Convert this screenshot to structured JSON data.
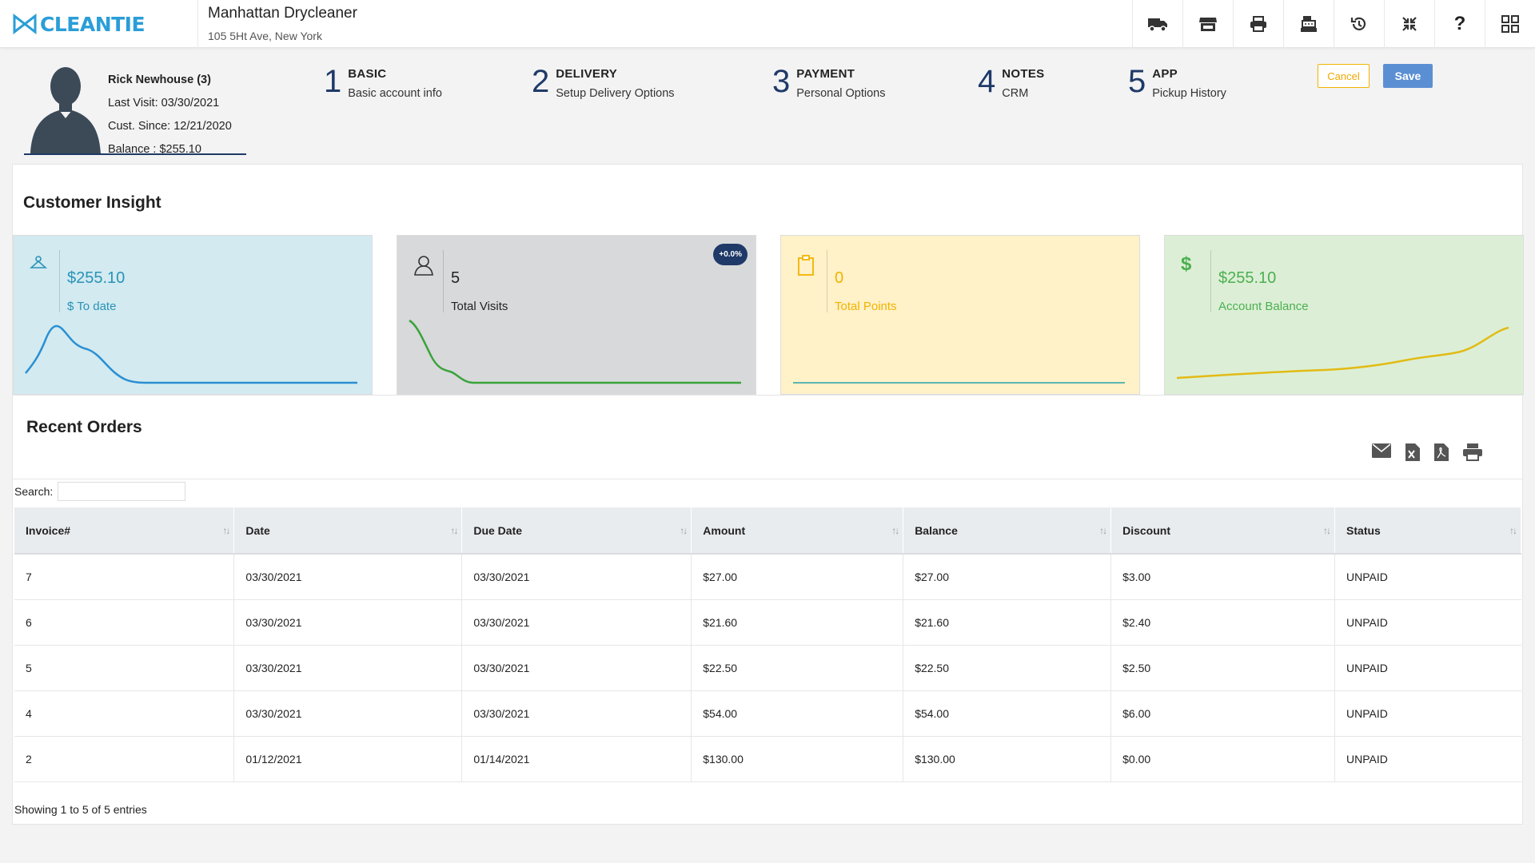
{
  "header": {
    "logo_text": "CLEANTIE",
    "store_name": "Manhattan Drycleaner",
    "store_address": "105 5Ht Ave, New York",
    "icons": [
      "truck-icon",
      "store-icon",
      "printer-icon",
      "cash-register-icon",
      "history-icon",
      "collapse-icon",
      "help-icon",
      "grid-icon"
    ]
  },
  "customer": {
    "name": "Rick Newhouse (3)",
    "last_visit": "Last Visit: 03/30/2021",
    "cust_since": "Cust. Since: 12/21/2020",
    "balance": "Balance : $255.10"
  },
  "steps": [
    {
      "num": "1",
      "title": "BASIC",
      "sub": "Basic account info"
    },
    {
      "num": "2",
      "title": "DELIVERY",
      "sub": "Setup Delivery Options"
    },
    {
      "num": "3",
      "title": "PAYMENT",
      "sub": "Personal Options"
    },
    {
      "num": "4",
      "title": "NOTES",
      "sub": "CRM"
    },
    {
      "num": "5",
      "title": "APP",
      "sub": "Pickup History"
    }
  ],
  "actions": {
    "cancel": "Cancel",
    "save": "Save"
  },
  "insight": {
    "title": "Customer Insight",
    "cards": [
      {
        "value": "$255.10",
        "label": "$ To date",
        "icon": "hanger-icon",
        "bg": "#d2eaf0",
        "color": "#2a93b8",
        "line": "#2a8fd3"
      },
      {
        "value": "5",
        "label": "Total Visits",
        "icon": "user-icon",
        "bg": "#d8d9db",
        "color": "#222222",
        "line": "#3aa33a",
        "badge": "+0.0%"
      },
      {
        "value": "0",
        "label": "Total Points",
        "icon": "clipboard-icon",
        "bg": "#fff1c8",
        "color": "#f0b400",
        "line": "#5bb7b0"
      },
      {
        "value": "$255.10",
        "label": "Account Balance",
        "icon": "dollar-icon",
        "bg": "#dcefd6",
        "color": "#4caf50",
        "line": "#e2bb14"
      }
    ]
  },
  "orders": {
    "title": "Recent Orders",
    "search_label": "Search:",
    "columns": [
      "Invoice#",
      "Date",
      "Due Date",
      "Amount",
      "Balance",
      "Discount",
      "Status"
    ],
    "rows": [
      [
        "7",
        "03/30/2021",
        "03/30/2021",
        "$27.00",
        "$27.00",
        "$3.00",
        "UNPAID"
      ],
      [
        "6",
        "03/30/2021",
        "03/30/2021",
        "$21.60",
        "$21.60",
        "$2.40",
        "UNPAID"
      ],
      [
        "5",
        "03/30/2021",
        "03/30/2021",
        "$22.50",
        "$22.50",
        "$2.50",
        "UNPAID"
      ],
      [
        "4",
        "03/30/2021",
        "03/30/2021",
        "$54.00",
        "$54.00",
        "$6.00",
        "UNPAID"
      ],
      [
        "2",
        "01/12/2021",
        "01/14/2021",
        "$130.00",
        "$130.00",
        "$0.00",
        "UNPAID"
      ]
    ],
    "info": "Showing 1 to 5 of 5 entries"
  }
}
